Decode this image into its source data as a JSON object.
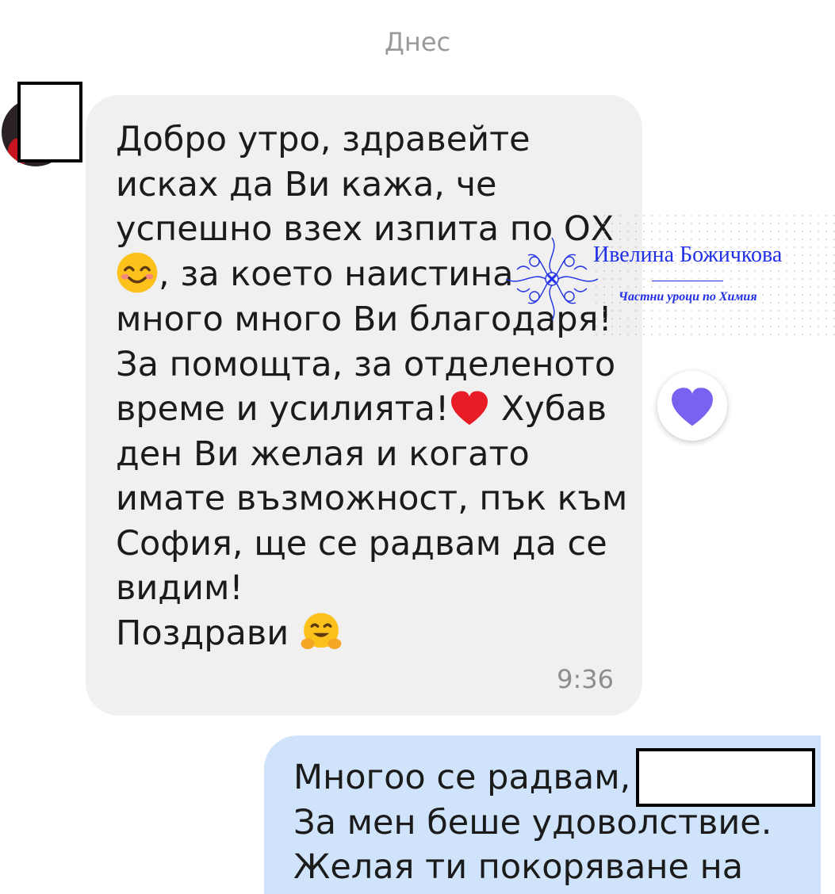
{
  "date_separator": "Днес",
  "incoming_message": {
    "lines": [
      "Добро утро, здравейте",
      "исках да Ви кажа, че",
      "успешно взех изпита по ОХ",
      ", за което наистина",
      "много много Ви благодаря!",
      "За помощта, за отделеното",
      "време и усилията!",
      " Хубав",
      "ден Ви желая и когато",
      "имате възможност, пък към",
      "София, ще се радвам да се",
      "видим!",
      "Поздрави "
    ],
    "emojis": [
      "smiling-face",
      "red-heart",
      "hugging-face"
    ],
    "time": "9:36",
    "reaction": "purple-heart"
  },
  "outgoing_message": {
    "lines": [
      "Многоо се радвам,",
      "За мен беше удоволствие.",
      "Желая ти покоряване на"
    ]
  },
  "watermark": {
    "name": "Ивелина Божичкова",
    "subtitle": "Частни уроци по Химия",
    "color": "#1f2fe6"
  },
  "colors": {
    "incoming_bubble": "#f0f0f0",
    "outgoing_bubble": "#cfe4fb",
    "reaction_heart": "#7b61f0"
  }
}
